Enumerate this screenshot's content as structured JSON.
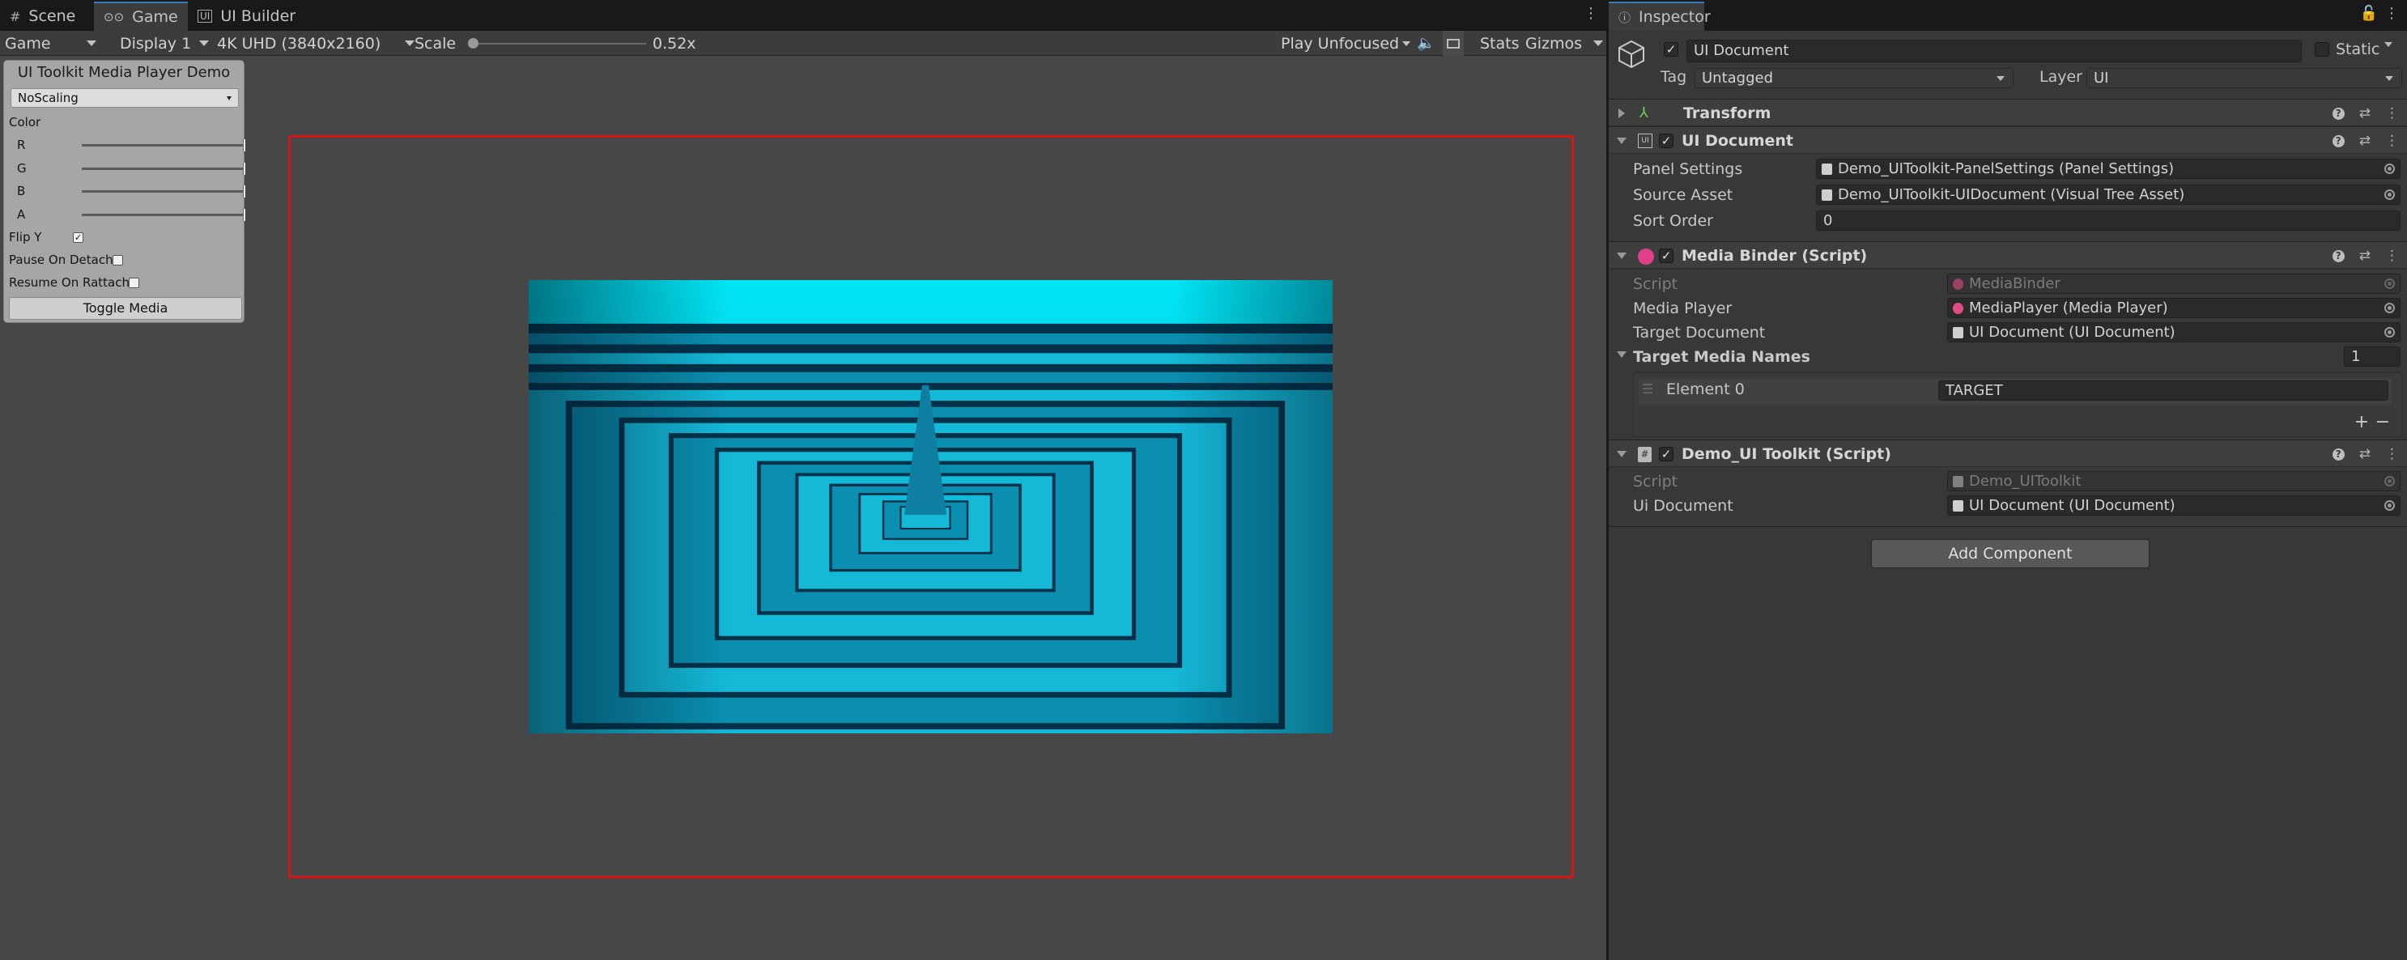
{
  "tabs": {
    "scene": "Scene",
    "game": "Game",
    "ui_builder": "UI Builder",
    "inspector": "Inspector"
  },
  "game_toolbar": {
    "view": "Game",
    "display": "Display 1",
    "resolution": "4K UHD (3840x2160)",
    "scale_label": "Scale",
    "scale_value": "0.52x",
    "play_mode": "Play Unfocused",
    "stats": "Stats",
    "gizmos": "Gizmos"
  },
  "demo_panel": {
    "title": "UI Toolkit Media Player Demo",
    "scaling_mode": "NoScaling",
    "color_label": "Color",
    "channels": [
      "R",
      "G",
      "B",
      "A"
    ],
    "channel_values": [
      1,
      1,
      1,
      1
    ],
    "flip_y_label": "Flip Y",
    "flip_y": true,
    "pause_on_detach_label": "Pause On Detach",
    "pause_on_detach": false,
    "resume_on_rattach_label": "Resume On Rattach",
    "resume_on_rattach": false,
    "toggle_button": "Toggle Media"
  },
  "inspector": {
    "object_name": "UI Document",
    "static_label": "Static",
    "tag_label": "Tag",
    "tag_value": "Untagged",
    "layer_label": "Layer",
    "layer_value": "UI",
    "components": {
      "transform": {
        "title": "Transform"
      },
      "ui_document": {
        "title": "UI Document",
        "panel_settings_label": "Panel Settings",
        "panel_settings_value": "Demo_UIToolkit-PanelSettings (Panel Settings)",
        "source_asset_label": "Source Asset",
        "source_asset_value": "Demo_UIToolkit-UIDocument (Visual Tree Asset)",
        "sort_order_label": "Sort Order",
        "sort_order_value": "0"
      },
      "media_binder": {
        "title": "Media Binder (Script)",
        "script_label": "Script",
        "script_value": "MediaBinder",
        "media_player_label": "Media Player",
        "media_player_value": "MediaPlayer (Media Player)",
        "target_document_label": "Target Document",
        "target_document_value": "UI Document (UI Document)",
        "target_names_label": "Target Media Names",
        "target_names_count": "1",
        "element0_label": "Element 0",
        "element0_value": "TARGET"
      },
      "demo_ui_toolkit": {
        "title": "Demo_UI Toolkit (Script)",
        "script_label": "Script",
        "script_value": "Demo_UIToolkit",
        "ui_document_label": "Ui Document",
        "ui_document_value": "UI Document (UI Document)"
      }
    },
    "add_component": "Add Component"
  },
  "colors": {
    "accent_red_frame": "#d11717",
    "video_cyan": "#00e4f5"
  }
}
